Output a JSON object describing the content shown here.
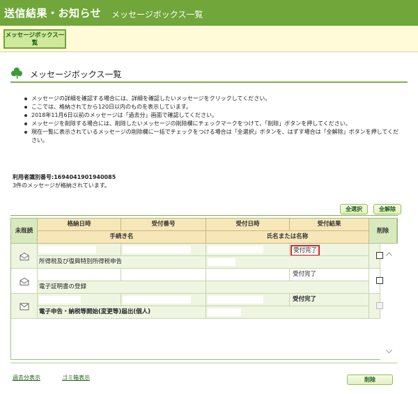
{
  "header": {
    "title": "送信結果・お知らせ",
    "subtitle": "メッセージボックス一覧"
  },
  "tab": {
    "label": "メッセージボックス一覧"
  },
  "section": {
    "title": "メッセージボックス一覧"
  },
  "instructions": [
    "メッセージの詳細を確認する場合には、詳細を確認したいメッセージをクリックしてください。",
    "ここでは、格納されてから120日以内のものを表示しています。",
    "2018年11月6日以前のメッセージは「過去分」画面で確認してください。",
    "メッセージを削除する場合には、削除したいメッセージの削除欄にチェックマークをつけて、「削除」ボタンを押してください。",
    "現在一覧に表示されているメッセージの削除欄に一括でチェックをつける場合は「全選択」ボタンを、はずす場合は「全解除」ボタンを押してください。"
  ],
  "user": {
    "id_text": "利用者識別番号:1694041901940085",
    "count_text": "3件のメッセージが格納されています。"
  },
  "buttons": {
    "select_all": "全選択",
    "clear_all": "全解除",
    "delete": "削除"
  },
  "table": {
    "headers": {
      "unread": "未既読",
      "stored_date": "格納日時",
      "receipt_no": "受付番号",
      "receipt_date": "受付日時",
      "result": "受付結果",
      "procedure": "手続き名",
      "name": "氏名または名称",
      "delete": "削除"
    },
    "rows": [
      {
        "status": "受付完了",
        "procedure": "所得税及び復興特別所得税申告",
        "read": true,
        "bold": false,
        "checkbox_enabled": true,
        "highlight": true
      },
      {
        "status": "受付完了",
        "procedure": "電子証明書の登録",
        "read": true,
        "bold": false,
        "checkbox_enabled": true,
        "highlight": false
      },
      {
        "status": "受付完了",
        "procedure": "電子申告・納税等開始(変更等)届出(個人)",
        "read": false,
        "bold": true,
        "checkbox_enabled": false,
        "highlight": false
      }
    ]
  },
  "links": {
    "past": "過去分表示",
    "trash": "ゴミ箱表示"
  },
  "colors": {
    "header_bg": "#70a63a",
    "tab_bar_bg": "#fffbd9",
    "highlight_border": "#d9262c"
  }
}
